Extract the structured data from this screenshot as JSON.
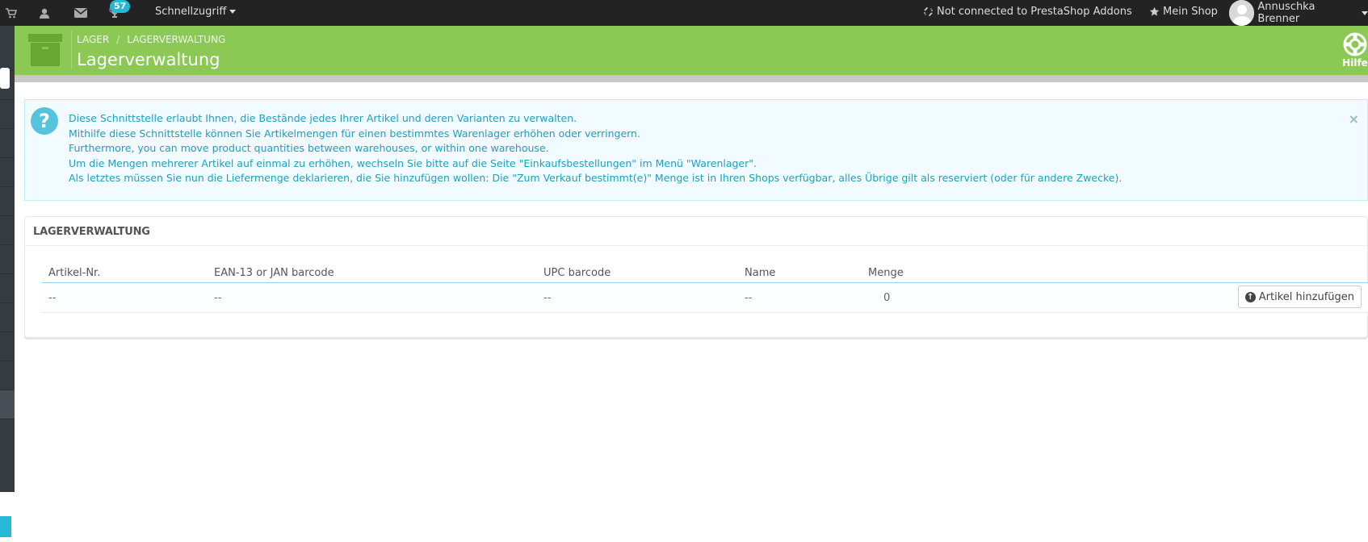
{
  "topbar": {
    "notifications_count": "57",
    "quick_access_label": "Schnellzugriff",
    "addons_status": "Not connected to PrestaShop Addons",
    "my_shop_label": "Mein Shop",
    "user_name": "Annuschka Brenner"
  },
  "header": {
    "breadcrumb_1": "LAGER",
    "breadcrumb_sep": "/",
    "breadcrumb_2": "LAGERVERWALTUNG",
    "title": "Lagerverwaltung",
    "help_label": "Hilfe"
  },
  "alert": {
    "lines": [
      "Diese Schnittstelle erlaubt Ihnen, die Bestände jedes Ihrer Artikel und deren Varianten zu verwalten.",
      "Mithilfe diese Schnittstelle können Sie Artikelmengen für einen bestimmtes Warenlager erhöhen oder verringern.",
      "Furthermore, you can move product quantities between warehouses, or within one warehouse.",
      "Um die Mengen mehrerer Artikel auf einmal zu erhöhen, wechseln Sie bitte auf die Seite \"Einkaufsbestellungen\" im Menü \"Warenlager\".",
      "Als letztes müssen Sie nun die Liefermenge deklarieren, die Sie hinzufügen wollen: Die \"Zum Verkauf bestimmt(e)\" Menge ist in Ihren Shops verfügbar, alles Übrige gilt als reserviert (oder für andere Zwecke)."
    ],
    "close_symbol": "×"
  },
  "panel": {
    "heading": "LAGERVERWALTUNG",
    "columns": [
      "Artikel-Nr.",
      "EAN-13 or JAN barcode",
      "UPC barcode",
      "Name",
      "Menge"
    ],
    "row": [
      "--",
      "--",
      "--",
      "--",
      "0"
    ],
    "add_button_label": "Artikel hinzufügen"
  }
}
